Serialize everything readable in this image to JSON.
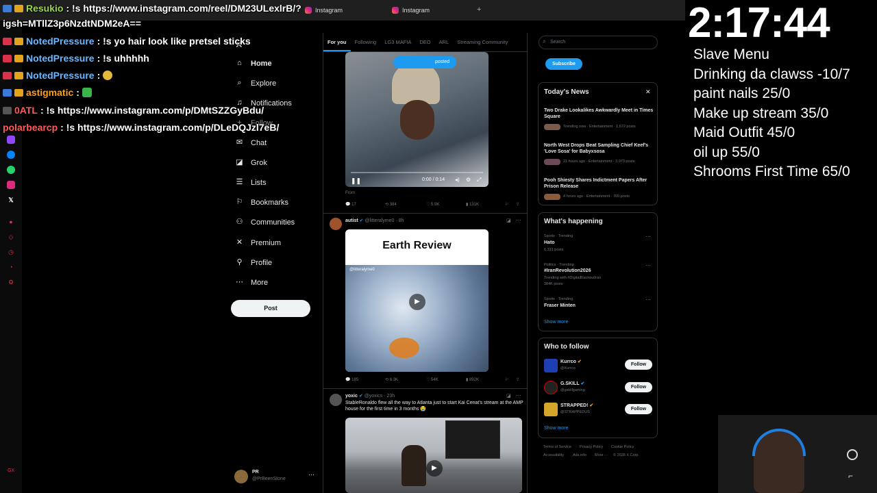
{
  "browser": {
    "tabs": [
      "Instagram",
      "Instagram"
    ],
    "new_tab": "+"
  },
  "chat": [
    {
      "user": "Resukio",
      "text": ": !s https://www.instagram.com/reel/DM23ULexlrB/?",
      "color": "#9bd64b"
    },
    {
      "user": "",
      "text": "igsh=MTllZ3p6NzdtNDM2eA==",
      "color": "#ffffff"
    },
    {
      "user": "NotedPressure",
      "text": ": !s yo hair look like pretsel sticks",
      "color": "#6ab7ff"
    },
    {
      "user": "NotedPressure",
      "text": ": !s uhhhhh",
      "color": "#6ab7ff"
    },
    {
      "user": "NotedPressure",
      "text": ":",
      "color": "#6ab7ff"
    },
    {
      "user": "astigmatic",
      "text": ":",
      "color": "#ff9f1a"
    },
    {
      "user": "0ATL",
      "text": ": !s https://www.instagram.com/p/DMtSZZGyBdu/",
      "color": "#ff5a5a"
    },
    {
      "user": "polarbearcp",
      "text": ": !s https://www.instagram.com/p/DLeDQJzl7eB/",
      "color": "#ff5a5a"
    }
  ],
  "nav": {
    "items": [
      {
        "label": "Home",
        "icon": "home-icon",
        "glyph": "⌂"
      },
      {
        "label": "Explore",
        "icon": "search-icon",
        "glyph": "⌕"
      },
      {
        "label": "Notifications",
        "icon": "bell-icon",
        "glyph": "♫"
      },
      {
        "label": "Follow",
        "icon": "follow-icon",
        "glyph": "+"
      },
      {
        "label": "Chat",
        "icon": "mail-icon",
        "glyph": "✉"
      },
      {
        "label": "Grok",
        "icon": "grok-icon",
        "glyph": "◪"
      },
      {
        "label": "Lists",
        "icon": "list-icon",
        "glyph": "☰"
      },
      {
        "label": "Bookmarks",
        "icon": "bookmark-icon",
        "glyph": "⚐"
      },
      {
        "label": "Communities",
        "icon": "communities-icon",
        "glyph": "⚇"
      },
      {
        "label": "Premium",
        "icon": "x-logo-icon",
        "glyph": "✕"
      },
      {
        "label": "Profile",
        "icon": "profile-icon",
        "glyph": "⚲"
      },
      {
        "label": "More",
        "icon": "more-icon",
        "glyph": "⋯"
      }
    ],
    "post_label": "Post",
    "profile": {
      "name": "PR",
      "handle": "@PrBeenStone"
    }
  },
  "timeline": {
    "tabs": [
      "For you",
      "Following",
      "LG3 MAFIA",
      "DEO",
      "ARL",
      "Streaming Community"
    ],
    "tweet1": {
      "posted_label": "posted",
      "video_time": "0:00 / 0:14",
      "from": "From",
      "stats": {
        "replies": "17",
        "reposts": "384",
        "likes": "5.9K",
        "views": "131K"
      }
    },
    "tweet2": {
      "name": "autist",
      "handle": "@litteralyme0",
      "time": "· 8h",
      "card_title": "Earth Review",
      "watermark": "@litteralyme0",
      "stats": {
        "replies": "185",
        "reposts": "6.3K",
        "likes": "54K",
        "views": "892K"
      }
    },
    "tweet3": {
      "name": "yoxic",
      "handle": "@yoxics",
      "time": "· 23h",
      "text": "StableRonaldo flew all the way to Atlanta just to start Kai Cenat's stream at the AMP house for the first time in 3 months 😭"
    }
  },
  "right": {
    "search_placeholder": "Search",
    "subscribe_label": "Subscribe",
    "news": {
      "title": "Today's News",
      "items": [
        {
          "headline": "Two Drake Lookalikes Awkwardly Meet in Times Square",
          "meta": "Trending now · Entertainment · 1,672 posts"
        },
        {
          "headline": "North West Drops Beat Sampling Chief Keef's 'Love Sosa' for Babyxsosa",
          "meta": "21 hours ago · Entertainment · 3,973 posts"
        },
        {
          "headline": "Pooh Shiesty Shares Indictment Papers After Prison Release",
          "meta": "4 hours ago · Entertainment · 705 posts"
        }
      ]
    },
    "happening": {
      "title": "What's happening",
      "items": [
        {
          "context": "Sports · Trending",
          "topic": "Hato",
          "detail": "6,331 posts"
        },
        {
          "context": "Politics · Trending",
          "topic": "#IranRevolution2026",
          "detail": "Trending with #DigitalBlackoutIran",
          "count": "384K posts"
        },
        {
          "context": "Sports · Trending",
          "topic": "Fraser Minten",
          "detail": ""
        }
      ],
      "show_more": "Show more"
    },
    "follow": {
      "title": "Who to follow",
      "items": [
        {
          "name": "Kurrco",
          "handle": "@Kurrco",
          "button": "Follow"
        },
        {
          "name": "G.SKILL",
          "handle": "@gskillgaming",
          "button": "Follow"
        },
        {
          "name": "STRAPPED!",
          "handle": "@STRAPPEDUS",
          "button": "Follow"
        }
      ],
      "show_more": "Show more"
    },
    "footer": [
      "Terms of Service",
      "Privacy Policy",
      "Cookie Policy",
      "Accessibility",
      "Ads info",
      "More ···",
      "© 2026 X Corp."
    ]
  },
  "overlay": {
    "timer": "2:17:44",
    "menu_items": [
      "Slave Menu",
      "Drinking da clawss -10/7",
      "paint nails 25/0",
      "Make up stream 35/0",
      "Maid Outfit 45/0",
      "oil up 55/0",
      "Shrooms First Time 65/0"
    ]
  },
  "colors": {
    "accent": "#1d9bf0",
    "bg": "#000000",
    "border": "#2f3336",
    "muted": "#71767b"
  }
}
